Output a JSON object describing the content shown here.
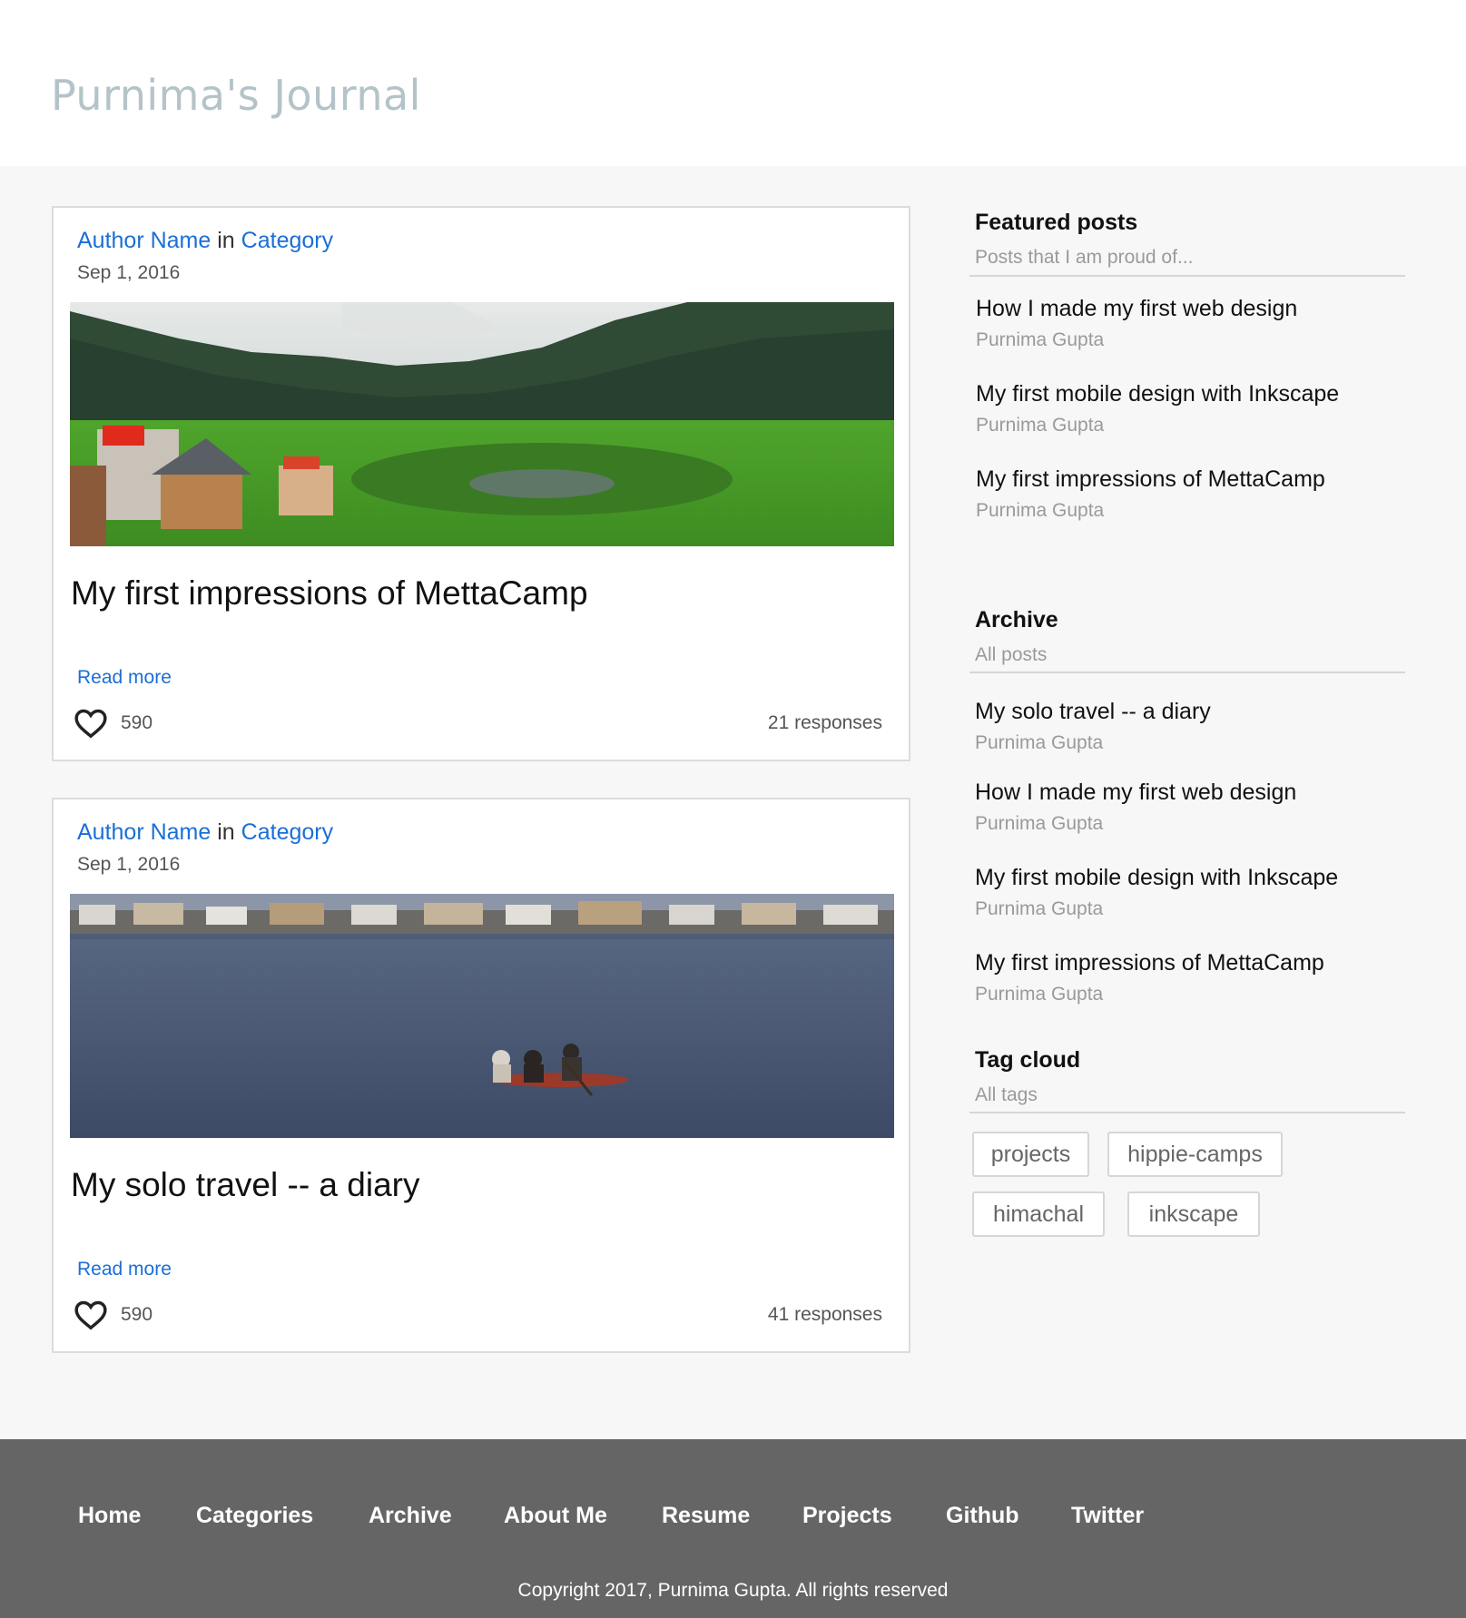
{
  "site": {
    "title": "Purnima's Journal"
  },
  "posts": [
    {
      "author": "Author Name",
      "in_word": "in",
      "category": "Category",
      "date": "Sep 1, 2016",
      "title": "My first impressions of MettaCamp",
      "read_more": "Read more",
      "likes": "590",
      "responses": "21 responses"
    },
    {
      "author": "Author Name",
      "in_word": "in",
      "category": "Category",
      "date": "Sep 1, 2016",
      "title": "My solo travel -- a diary",
      "read_more": "Read more",
      "likes": "590",
      "responses": "41 responses"
    }
  ],
  "featured": {
    "heading": "Featured posts",
    "subheading": "Posts that I am proud of...",
    "items": [
      {
        "title": "How I made my first web design",
        "author": "Purnima Gupta"
      },
      {
        "title": "My first mobile design with Inkscape",
        "author": "Purnima Gupta"
      },
      {
        "title": "My first impressions of MettaCamp",
        "author": "Purnima Gupta"
      }
    ]
  },
  "archive": {
    "heading": "Archive",
    "subheading": "All posts",
    "items": [
      {
        "title": "My solo travel -- a diary",
        "author": "Purnima Gupta"
      },
      {
        "title": "How I made my first web design",
        "author": "Purnima Gupta"
      },
      {
        "title": "My first mobile design with Inkscape",
        "author": "Purnima Gupta"
      },
      {
        "title": "My first impressions of MettaCamp",
        "author": "Purnima Gupta"
      }
    ]
  },
  "tags": {
    "heading": "Tag cloud",
    "subheading": "All tags",
    "items": [
      "projects",
      "hippie-camps",
      "himachal",
      "inkscape"
    ]
  },
  "footer": {
    "nav": [
      "Home",
      "Categories",
      "Archive",
      "About Me",
      "Resume",
      "Projects",
      "Github",
      "Twitter"
    ],
    "copyright": "Copyright 2017, Purnima Gupta. All rights reserved"
  },
  "icons": {
    "like": "heart-outline-icon"
  },
  "colors": {
    "link": "#1a6fd6",
    "site_title": "#b4c3c8",
    "footer_bg": "#656565",
    "page_bg": "#f7f7f7"
  }
}
